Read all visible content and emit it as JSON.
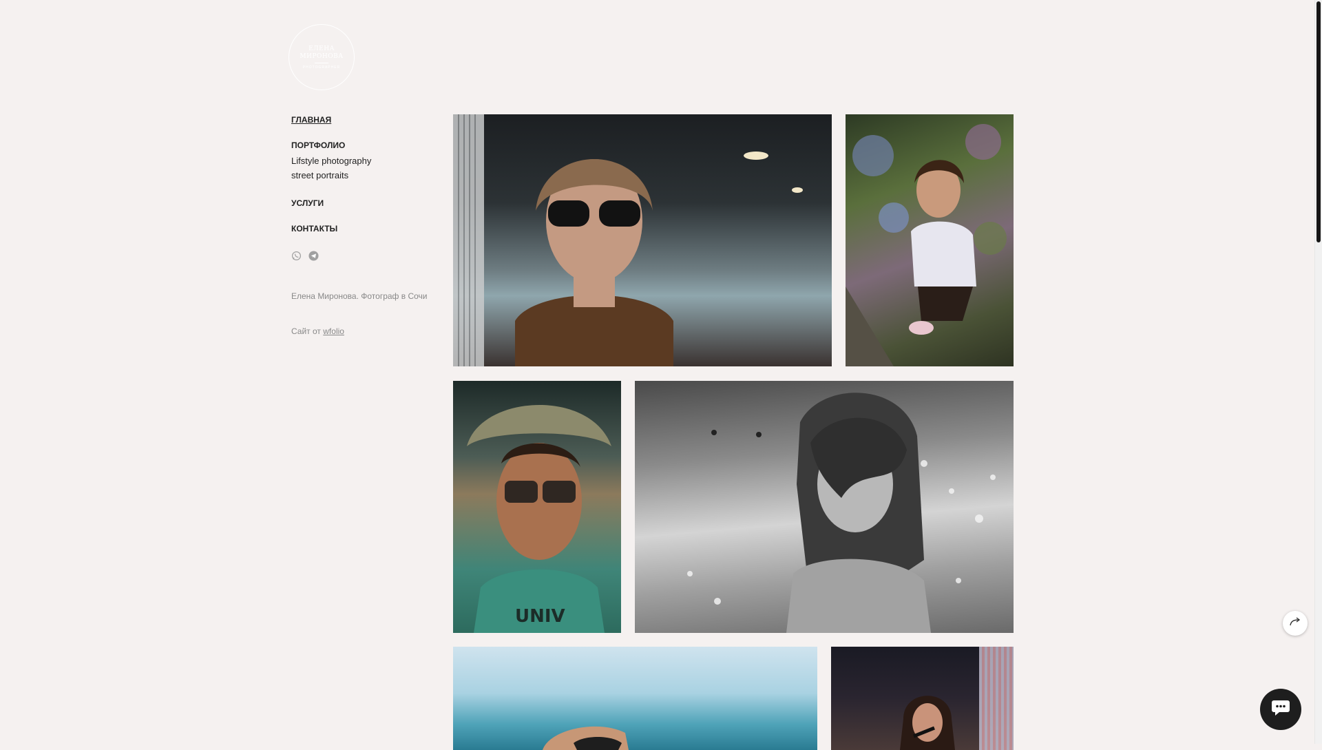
{
  "logo": {
    "line1": "ЕЛЕНА",
    "line2": "МИРОНОВА",
    "line3": "PHOTOGRAPHER"
  },
  "nav": {
    "home": "ГЛАВНАЯ",
    "portfolio": "ПОРТФОЛИО",
    "portfolio_items": [
      "Lifstyle photography",
      "street portraits"
    ],
    "services": "УСЛУГИ",
    "contacts": "КОНТАКТЫ"
  },
  "socials": [
    "whatsapp-icon",
    "telegram-icon"
  ],
  "footer": {
    "tagline": "Елена Миронова. Фотограф в Сочи",
    "credit_prefix": "Сайт от",
    "credit_link": "wfolio"
  },
  "gallery": [
    {
      "name": "photo-woman-sunglasses"
    },
    {
      "name": "photo-girl-hydrangeas"
    },
    {
      "name": "photo-man-hat"
    },
    {
      "name": "photo-girl-sea-bw"
    },
    {
      "name": "photo-sea-portrait"
    },
    {
      "name": "photo-singer"
    }
  ],
  "colors": {
    "background": "#f5f1f0",
    "text": "#222222",
    "muted": "#888888",
    "chat_button": "#1e1e1e"
  },
  "widgets": {
    "share": "share-icon",
    "chat": "chat-icon"
  }
}
